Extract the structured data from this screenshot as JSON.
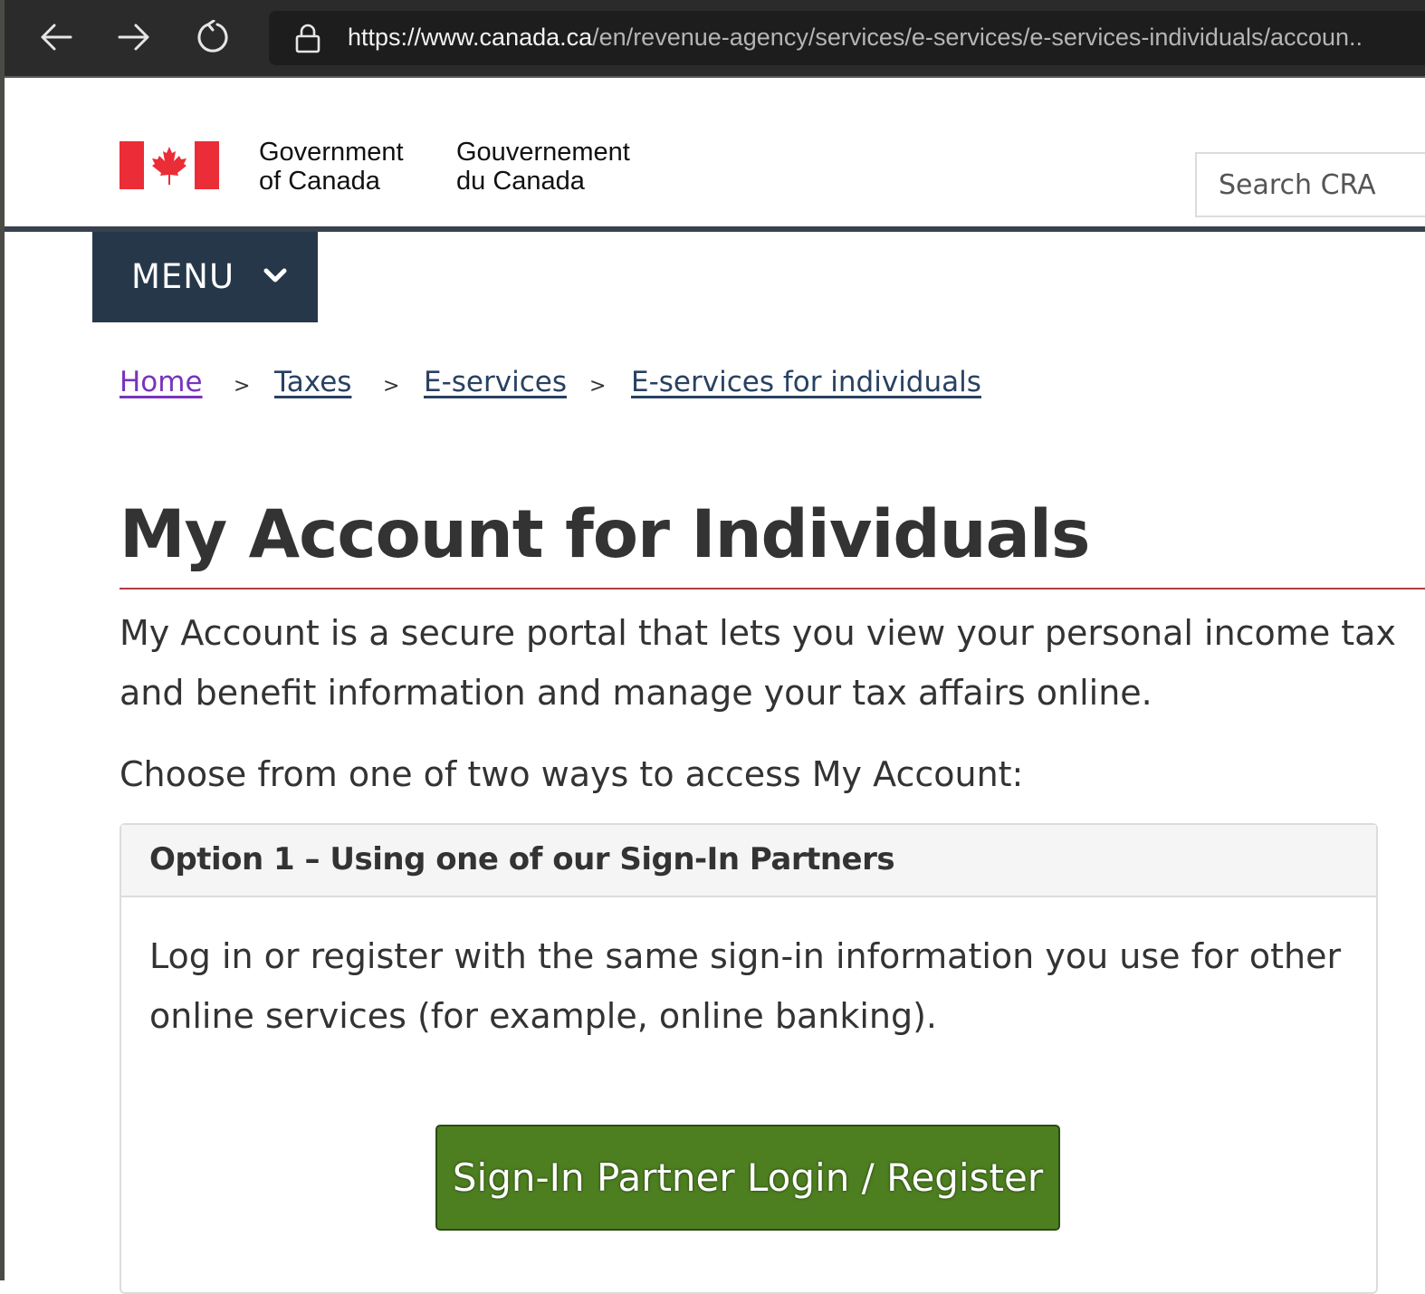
{
  "browser": {
    "url_host_part": "https://www.canada.ca",
    "url_path_part": "/en/revenue-agency/services/e-services/e-services-individuals/accoun..",
    "icons": [
      "back-arrow-icon",
      "forward-arrow-icon",
      "reload-icon",
      "lock-icon"
    ]
  },
  "header": {
    "flag_icon": "canada-flag-icon",
    "signature_en_line1": "Government",
    "signature_en_line2": "of Canada",
    "signature_fr_line1": "Gouvernement",
    "signature_fr_line2": "du Canada",
    "search_placeholder": "Search CRA"
  },
  "menu": {
    "label": "MENU",
    "icon": "chevron-down-icon"
  },
  "breadcrumb": [
    {
      "label": "Home",
      "visited": true
    },
    {
      "label": "Taxes"
    },
    {
      "label": "E-services"
    },
    {
      "label": "E-services for individuals"
    }
  ],
  "breadcrumb_separator": ">",
  "main": {
    "title": "My Account for Individuals",
    "intro_line1": "My Account is a secure portal that lets you view your personal income tax",
    "intro_line2": "and benefit information and manage your tax affairs online.",
    "choose_text": "Choose from one of two ways to access My Account:"
  },
  "option1": {
    "title": "Option 1 – Using one of our Sign-In Partners",
    "body_line1": "Log in or register with the same sign-in information you use for other",
    "body_line2": "online services (for example, online banking).",
    "button_label": "Sign-In Partner Login / Register"
  },
  "colors": {
    "chrome_bg": "#2b2b2b",
    "menu_bg": "#26374a",
    "header_rule": "#38414d",
    "link": "#284162",
    "link_visited": "#7834bc",
    "title_rule": "#af3c43",
    "button_green": "#4d7f20",
    "flag_red": "#eb2d37"
  }
}
